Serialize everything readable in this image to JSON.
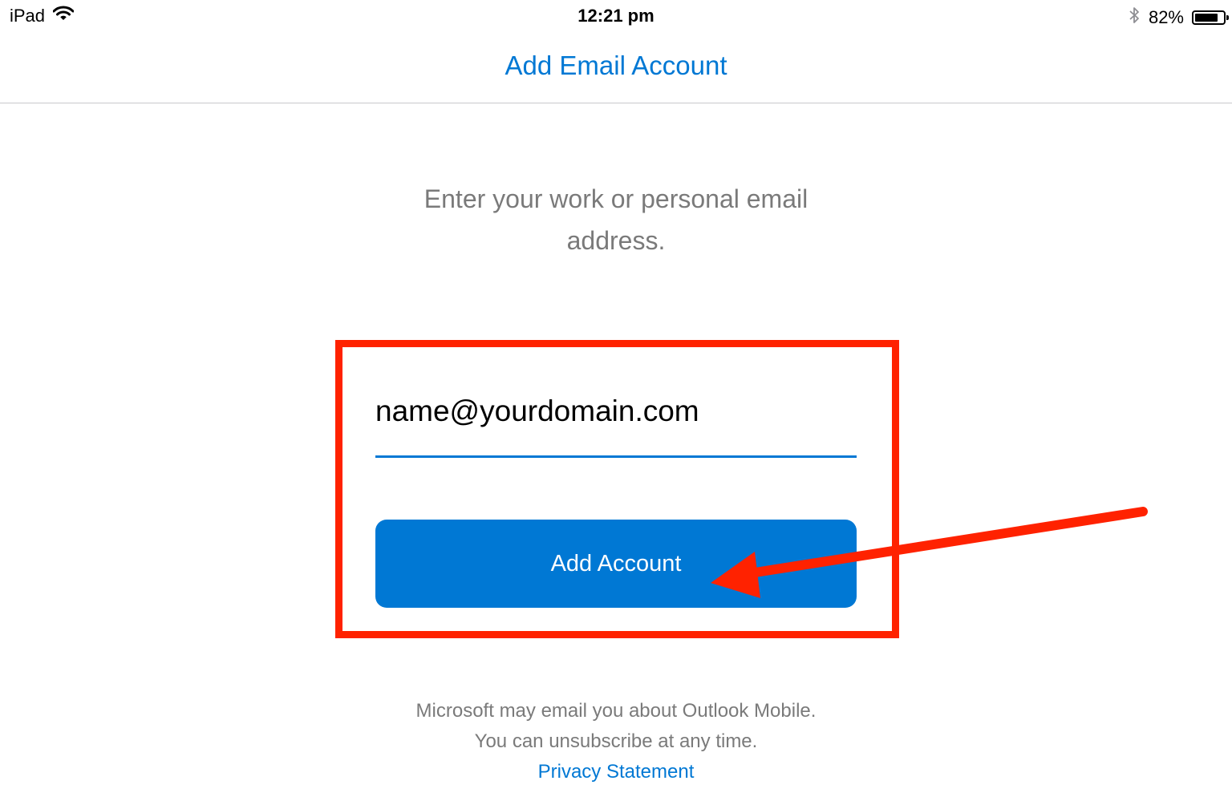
{
  "status_bar": {
    "device": "iPad",
    "time": "12:21 pm",
    "battery_percent": "82%",
    "battery_level": 0.82,
    "icons": [
      "wifi-icon",
      "bluetooth-icon",
      "battery-icon"
    ]
  },
  "nav": {
    "title": "Add Email Account"
  },
  "prompt": {
    "text": "Enter your work or personal email address."
  },
  "email": {
    "value": "name@yourdomain.com"
  },
  "button": {
    "label": "Add Account"
  },
  "footer": {
    "line1": "Microsoft may email you about Outlook Mobile.",
    "line2": "You can unsubscribe at any time.",
    "privacy_link": "Privacy Statement"
  },
  "colors": {
    "accent": "#0078d4",
    "annotation": "#ff2200",
    "muted_text": "#7a7a7a"
  }
}
